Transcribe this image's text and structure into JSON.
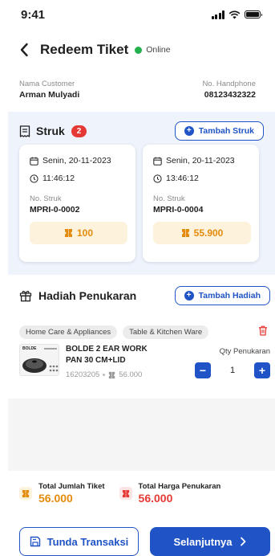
{
  "status_bar": {
    "time": "9:41"
  },
  "header": {
    "title": "Redeem Tiket",
    "status": "Online"
  },
  "customer": {
    "name_label": "Nama Customer",
    "name": "Arman Mulyadi",
    "phone_label": "No. Handphone",
    "phone": "08123432322"
  },
  "struk": {
    "title": "Struk",
    "count": "2",
    "add_label": "Tambah Struk",
    "items": [
      {
        "date": "Senin, 20-11-2023",
        "time": "11:46:12",
        "no_label": "No. Struk",
        "no": "MPRI-0-0002",
        "tickets": "100"
      },
      {
        "date": "Senin, 20-11-2023",
        "time": "13:46:12",
        "no_label": "No. Struk",
        "no": "MPRI-0-0004",
        "tickets": "55.900"
      }
    ]
  },
  "hadiah": {
    "title": "Hadiah Penukaran",
    "add_label": "Tambah Hadiah",
    "categories": [
      "Home Care & Appliances",
      "Table & Kitchen Ware"
    ],
    "product": {
      "name": "BOLDE 2 EAR WORK PAN 30 CM+LID",
      "sku": "16203205",
      "price": "56.000",
      "brand": "BOLDE",
      "qty_label": "Qty Penukaran",
      "qty": "1"
    }
  },
  "totals": {
    "tiket_label": "Total Jumlah Tiket",
    "tiket_value": "56.000",
    "harga_label": "Total Harga Penukaran",
    "harga_value": "56.000"
  },
  "footer": {
    "tunda_label": "Tunda Transaksi",
    "next_label": "Selanjutnya"
  },
  "colors": {
    "primary": "#1f53c6",
    "ticket": "#e58b0b",
    "danger": "#e53935",
    "online": "#22b14c"
  },
  "icons": [
    "back-icon",
    "receipt-icon",
    "calendar-icon",
    "clock-icon",
    "ticket-icon",
    "gift-icon",
    "trash-icon",
    "save-icon",
    "chevron-right-icon",
    "plus-circle-icon"
  ]
}
